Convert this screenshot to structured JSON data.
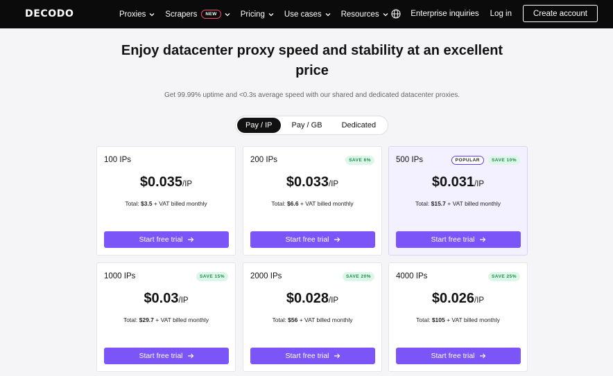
{
  "nav": {
    "logo": "DECODO",
    "menu": [
      {
        "label": "Proxies"
      },
      {
        "label": "Scrapers",
        "badge": "NEW"
      },
      {
        "label": "Pricing"
      },
      {
        "label": "Use cases"
      },
      {
        "label": "Resources"
      }
    ],
    "enterprise": "Enterprise inquiries",
    "login": "Log in",
    "create_account": "Create account"
  },
  "hero": {
    "headline_line1": "Enjoy datacenter proxy speed and stability at an excellent",
    "headline_line2": "price",
    "subtitle": "Get 99.99% uptime and <0.3s average speed with our shared and dedicated datacenter proxies."
  },
  "toggle": {
    "options": [
      "Pay / IP",
      "Pay / GB",
      "Dedicated"
    ],
    "selected": "Pay / IP"
  },
  "plans": [
    {
      "title": "100 IPs",
      "price": "$0.035",
      "unit": "/IP",
      "total_prefix": "Total: ",
      "total_amount": "$3.5",
      "total_suffix": " + VAT billed monthly",
      "save": "",
      "popular": "",
      "cta": "Start free trial"
    },
    {
      "title": "200 IPs",
      "price": "$0.033",
      "unit": "/IP",
      "total_prefix": "Total: ",
      "total_amount": "$6.6",
      "total_suffix": " + VAT billed monthly",
      "save": "SAVE 6%",
      "popular": "",
      "cta": "Start free trial"
    },
    {
      "title": "500 IPs",
      "price": "$0.031",
      "unit": "/IP",
      "total_prefix": "Total: ",
      "total_amount": "$15.7",
      "total_suffix": " + VAT billed monthly",
      "save": "SAVE 10%",
      "popular": "POPULAR",
      "cta": "Start free trial"
    },
    {
      "title": "1000 IPs",
      "price": "$0.03",
      "unit": "/IP",
      "total_prefix": "Total: ",
      "total_amount": "$29.7",
      "total_suffix": " + VAT billed monthly",
      "save": "SAVE 15%",
      "popular": "",
      "cta": "Start free trial"
    },
    {
      "title": "2000 IPs",
      "price": "$0.028",
      "unit": "/IP",
      "total_prefix": "Total: ",
      "total_amount": "$56",
      "total_suffix": " + VAT billed monthly",
      "save": "SAVE 20%",
      "popular": "",
      "cta": "Start free trial"
    },
    {
      "title": "4000 IPs",
      "price": "$0.026",
      "unit": "/IP",
      "total_prefix": "Total: ",
      "total_amount": "$105",
      "total_suffix": " + VAT billed monthly",
      "save": "SAVE 25%",
      "popular": "",
      "cta": "Start free trial"
    }
  ],
  "colors": {
    "accent": "#7b55f7",
    "nav_bg": "#0b0b0b",
    "save_bg": "#dcf7e7",
    "save_text": "#1e8a4c",
    "popular_card_bg": "#f3f1ff"
  }
}
